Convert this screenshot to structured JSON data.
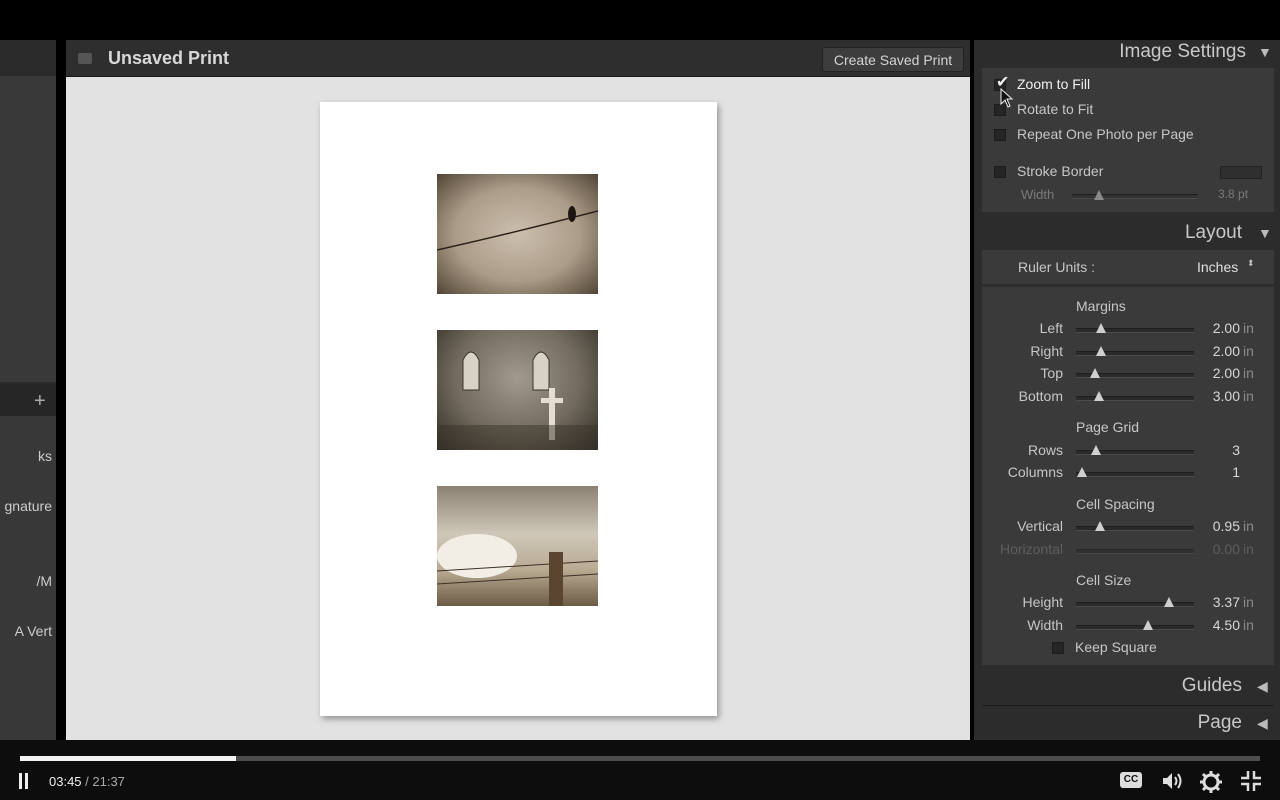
{
  "window": {
    "title": "Unsaved Print",
    "create_saved_print_label": "Create Saved Print"
  },
  "left_panel": {
    "templates": [
      "ks",
      "gnature",
      "/M",
      "A Vert"
    ]
  },
  "image_settings": {
    "header": "Image Settings",
    "zoom_to_fill": {
      "label": "Zoom to Fill",
      "checked": true
    },
    "rotate_to_fit": {
      "label": "Rotate to Fit",
      "checked": false
    },
    "repeat_one_photo": {
      "label": "Repeat One Photo per Page",
      "checked": false
    },
    "stroke_border": {
      "label": "Stroke Border",
      "checked": false,
      "color": "#2f2f2f"
    },
    "width": {
      "label": "Width",
      "value": "3.8 pt",
      "fraction": 0.2
    }
  },
  "layout": {
    "header": "Layout",
    "ruler_units_label": "Ruler Units :",
    "ruler_units_value": "Inches",
    "unit": "in",
    "margins": {
      "title": "Margins",
      "items": [
        {
          "label": "Left",
          "value": "2.00",
          "fraction": 0.22
        },
        {
          "label": "Right",
          "value": "2.00",
          "fraction": 0.22
        },
        {
          "label": "Top",
          "value": "2.00",
          "fraction": 0.17
        },
        {
          "label": "Bottom",
          "value": "3.00",
          "fraction": 0.2
        }
      ]
    },
    "page_grid": {
      "title": "Page Grid",
      "items": [
        {
          "label": "Rows",
          "value": "3",
          "fraction": 0.17
        },
        {
          "label": "Columns",
          "value": "1",
          "fraction": 0.05
        }
      ]
    },
    "cell_spacing": {
      "title": "Cell Spacing",
      "items": [
        {
          "label": "Vertical",
          "value": "0.95",
          "fraction": 0.2
        },
        {
          "label": "Horizontal",
          "value": "0.00",
          "fraction": 0
        }
      ]
    },
    "cell_size": {
      "title": "Cell Size",
      "items": [
        {
          "label": "Height",
          "value": "3.37",
          "fraction": 0.79
        },
        {
          "label": "Width",
          "value": "4.50",
          "fraction": 0.61
        }
      ],
      "keep_square": {
        "label": "Keep Square",
        "checked": false
      }
    }
  },
  "guides": {
    "header": "Guides"
  },
  "page": {
    "header": "Page"
  },
  "player": {
    "current_time": "03:45",
    "total_time": " / 21:37",
    "progress": 0.174,
    "cc_label": "CC"
  }
}
